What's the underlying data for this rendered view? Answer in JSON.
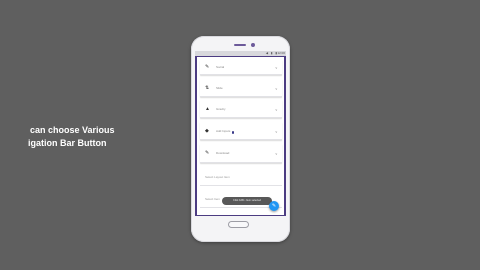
{
  "caption": {
    "line1": "can choose Various",
    "line2": "igation Bar Button"
  },
  "status_bar": {
    "icons": "◀ ▮ ▮",
    "time": "12:00"
  },
  "rows": [
    {
      "icon": "✎",
      "icon_name": "pencil-icon",
      "label": "Social",
      "chevron": "⌄"
    },
    {
      "icon": "⇅",
      "icon_name": "arrows-icon",
      "label": "Slide",
      "chevron": "⌄"
    },
    {
      "icon": "▲",
      "icon_name": "triangle-icon",
      "label": "Gravity",
      "chevron": "⌄"
    },
    {
      "icon": "◆",
      "icon_name": "diamond-icon",
      "label": "Add Inputs",
      "chevron": "⌄"
    },
    {
      "icon": "✎",
      "icon_name": "pencil-icon",
      "label": "Download",
      "chevron": "⌄"
    }
  ],
  "fields": [
    {
      "label": "Select Layout Item"
    },
    {
      "label": "Select Item"
    }
  ],
  "toast": {
    "text": "Click FAB • Item selected"
  },
  "fab": {
    "icon": "✎",
    "icon_name": "edit-icon"
  },
  "colors": {
    "background": "#5f5f5f",
    "phone_body": "#f4f4f6",
    "screen_accent": "#4c3c82",
    "fab": "#2196f3",
    "toast": "#585858"
  }
}
